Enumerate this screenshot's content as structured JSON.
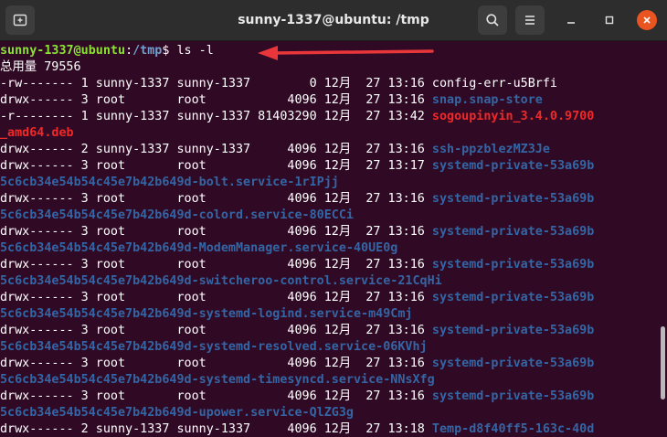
{
  "window": {
    "title": "sunny-1337@ubuntu: /tmp",
    "colors": {
      "background": "#300a24",
      "titlebar": "#2d2d2d",
      "close": "#e95420",
      "user": "#8ae234",
      "path": "#729fcf",
      "directory": "#3465a4",
      "archive": "#ef2929",
      "annotation_arrow": "#e8363a"
    },
    "icons": {
      "new_tab": "new-tab-icon",
      "search": "search-icon",
      "menu": "menu-icon",
      "minimize": "minimize-icon",
      "maximize": "maximize-icon",
      "close": "close-icon"
    }
  },
  "terminal": {
    "prompt": {
      "user_host": "sunny-1337@ubuntu",
      "sep": ":",
      "path": "/tmp",
      "symbol": "$ ",
      "command": "ls -l"
    },
    "total": "总用量 79556",
    "entries": [
      {
        "perm": "-rw------- 1 sunny-1337 sunny-1337        0 12月  27 13:16 ",
        "name": "config-err-u5Brfi",
        "kind": "file"
      },
      {
        "perm": "drwx------ 3 root       root           4096 12月  27 13:16 ",
        "name": "snap.snap-store",
        "kind": "dir"
      },
      {
        "perm": "-r-------- 1 sunny-1337 sunny-1337 81403290 12月  27 13:42 ",
        "name": "sogoupinyin_3.4.0.9700",
        "cont": "_amd64.deb",
        "kind": "deb"
      },
      {
        "perm": "drwx------ 2 sunny-1337 sunny-1337     4096 12月  27 13:16 ",
        "name": "ssh-ppzblezMZ3Je",
        "kind": "dir"
      },
      {
        "perm": "drwx------ 3 root       root           4096 12月  27 13:17 ",
        "name": "systemd-private-53a69b",
        "cont": "5c6cb34e54b54c45e7b42b649d-bolt.service-1rIPjj",
        "kind": "dir"
      },
      {
        "perm": "drwx------ 3 root       root           4096 12月  27 13:16 ",
        "name": "systemd-private-53a69b",
        "cont": "5c6cb34e54b54c45e7b42b649d-colord.service-80ECCi",
        "kind": "dir"
      },
      {
        "perm": "drwx------ 3 root       root           4096 12月  27 13:16 ",
        "name": "systemd-private-53a69b",
        "cont": "5c6cb34e54b54c45e7b42b649d-ModemManager.service-40UE0g",
        "kind": "dir"
      },
      {
        "perm": "drwx------ 3 root       root           4096 12月  27 13:16 ",
        "name": "systemd-private-53a69b",
        "cont": "5c6cb34e54b54c45e7b42b649d-switcheroo-control.service-21CqHi",
        "kind": "dir"
      },
      {
        "perm": "drwx------ 3 root       root           4096 12月  27 13:16 ",
        "name": "systemd-private-53a69b",
        "cont": "5c6cb34e54b54c45e7b42b649d-systemd-logind.service-m49Cmj",
        "kind": "dir"
      },
      {
        "perm": "drwx------ 3 root       root           4096 12月  27 13:16 ",
        "name": "systemd-private-53a69b",
        "cont": "5c6cb34e54b54c45e7b42b649d-systemd-resolved.service-06KVhj",
        "kind": "dir"
      },
      {
        "perm": "drwx------ 3 root       root           4096 12月  27 13:16 ",
        "name": "systemd-private-53a69b",
        "cont": "5c6cb34e54b54c45e7b42b649d-systemd-timesyncd.service-NNsXfg",
        "kind": "dir"
      },
      {
        "perm": "drwx------ 3 root       root           4096 12月  27 13:16 ",
        "name": "systemd-private-53a69b",
        "cont": "5c6cb34e54b54c45e7b42b649d-upower.service-QlZG3g",
        "kind": "dir"
      },
      {
        "perm": "drwx------ 2 sunny-1337 sunny-1337     4096 12月  27 13:18 ",
        "name": "Temp-d8f40ff5-163c-40d",
        "kind": "dir"
      }
    ]
  }
}
